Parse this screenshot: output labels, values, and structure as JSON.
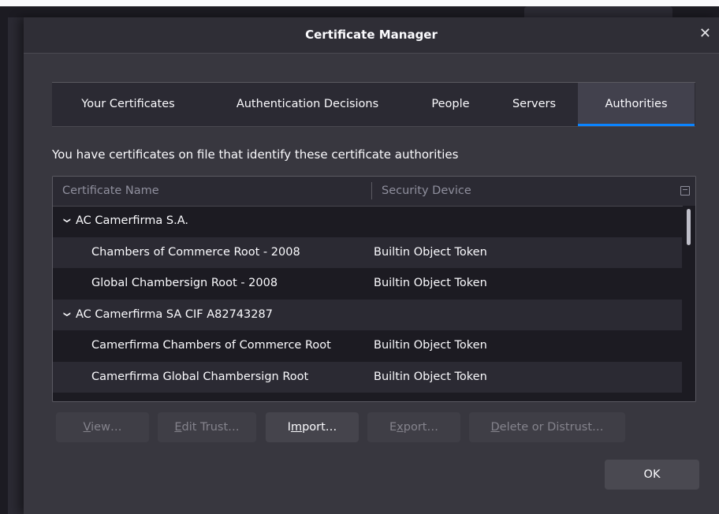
{
  "dialog": {
    "title": "Certificate Manager",
    "close_glyph": "✕"
  },
  "tabs": [
    {
      "label": "Your Certificates",
      "selected": false
    },
    {
      "label": "Authentication Decisions",
      "selected": false
    },
    {
      "label": "People",
      "selected": false
    },
    {
      "label": "Servers",
      "selected": false
    },
    {
      "label": "Authorities",
      "selected": true
    }
  ],
  "description": "You have certificates on file that identify these certificate authorities",
  "tree": {
    "columns": [
      "Certificate Name",
      "Security Device"
    ],
    "rows": [
      {
        "name": "AC Camerfirma S.A.",
        "device": "",
        "group": true
      },
      {
        "name": "Chambers of Commerce Root - 2008",
        "device": "Builtin Object Token",
        "group": false
      },
      {
        "name": "Global Chambersign Root - 2008",
        "device": "Builtin Object Token",
        "group": false
      },
      {
        "name": "AC Camerfirma SA CIF A82743287",
        "device": "",
        "group": true
      },
      {
        "name": "Camerfirma Chambers of Commerce Root",
        "device": "Builtin Object Token",
        "group": false
      },
      {
        "name": "Camerfirma Global Chambersign Root",
        "device": "Builtin Object Token",
        "group": false
      }
    ]
  },
  "buttons": {
    "view": {
      "access": "V",
      "rest": "iew…",
      "enabled": false
    },
    "edit_trust": {
      "access": "E",
      "rest": "dit Trust…",
      "enabled": false
    },
    "import": {
      "pre": "I",
      "access": "m",
      "rest": "port…",
      "enabled": true
    },
    "export": {
      "pre": "E",
      "access": "x",
      "rest": "port…",
      "enabled": false
    },
    "delete": {
      "access": "D",
      "rest": "elete or Distrust…",
      "enabled": false
    },
    "ok": "OK"
  },
  "colors": {
    "accent": "#0a84ff",
    "dialog_bg": "#38373f",
    "tree_bg": "#1c1b22"
  }
}
